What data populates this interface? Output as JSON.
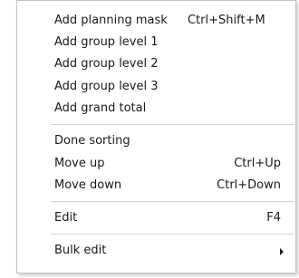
{
  "menu": {
    "add_planning_mask": {
      "label": "Add planning mask",
      "shortcut": "Ctrl+Shift+M"
    },
    "add_group_level_1": {
      "label": "Add group level 1"
    },
    "add_group_level_2": {
      "label": "Add group level 2"
    },
    "add_group_level_3": {
      "label": "Add group level 3"
    },
    "add_grand_total": {
      "label": "Add grand total"
    },
    "done_sorting": {
      "label": "Done sorting"
    },
    "move_up": {
      "label": "Move up",
      "shortcut": "Ctrl+Up"
    },
    "move_down": {
      "label": "Move down",
      "shortcut": "Ctrl+Down"
    },
    "edit": {
      "label": "Edit",
      "shortcut": "F4"
    },
    "bulk_edit": {
      "label": "Bulk edit",
      "submenu_icon": "chevron-right-icon"
    }
  }
}
